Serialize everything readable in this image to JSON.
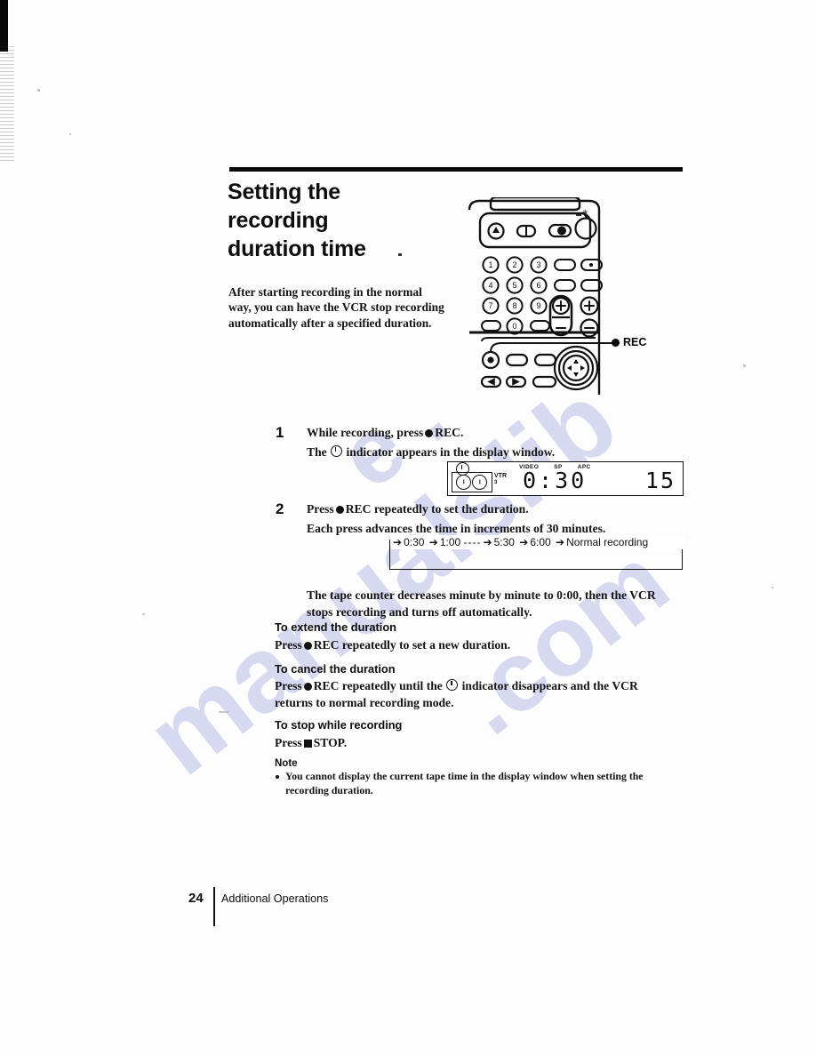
{
  "page": {
    "title_line1": "Setting the",
    "title_line2": "recording",
    "title_line3": "duration time",
    "intro": "After starting recording in the normal way, you can have the VCR stop recording automatically after a specified duration."
  },
  "illustration": {
    "callout_label": "REC",
    "keypad": [
      "1",
      "2",
      "3",
      "4",
      "5",
      "6",
      "7",
      "8",
      "9",
      "0"
    ],
    "plus_label": "+",
    "minus_label": "−"
  },
  "steps": [
    {
      "number": "1",
      "line1_pre": "While recording, press",
      "line1_post": "REC.",
      "line2_pre": "The",
      "line2_post": "indicator appears in the display window."
    },
    {
      "number": "2",
      "line1_pre": "Press",
      "line1_post": "REC repeatedly to set the duration.",
      "line2": "Each press advances the time in increments of 30 minutes."
    }
  ],
  "display_window": {
    "vtr_label": "VTR",
    "vtr_number": "3",
    "top_labels": [
      "VIDEO",
      "SP",
      "APC"
    ],
    "time": "0:30",
    "counter": "15"
  },
  "cycle": {
    "items": [
      "0:30",
      "1:00",
      "5:30",
      "6:00",
      "Normal recording"
    ],
    "dash_run": "----"
  },
  "after_cycle": "The tape counter decreases minute by minute to 0:00, then the VCR stops recording and turns off automatically.",
  "sections": [
    {
      "heading": "To extend the duration",
      "text_pre": "Press",
      "text_post": "REC repeatedly to set a new duration."
    },
    {
      "heading": "To cancel the duration",
      "text_pre": "Press",
      "text_mid": "REC repeatedly until the",
      "text_post": "indicator disappears and the VCR returns to normal recording mode."
    },
    {
      "heading": "To stop while recording",
      "text_pre": "Press",
      "text_post": "STOP."
    }
  ],
  "note": {
    "heading": "Note",
    "text": "You cannot display the current tape time in the display window when setting the recording duration."
  },
  "footer": {
    "page_number": "24",
    "section_label": "Additional Operations"
  },
  "watermark": {
    "part1": "manualslib",
    "part2": ".com",
    "part3": "e ."
  },
  "colors": {
    "ink": "#111111",
    "watermark": "#b9bce8",
    "paper": "#ffffff"
  }
}
